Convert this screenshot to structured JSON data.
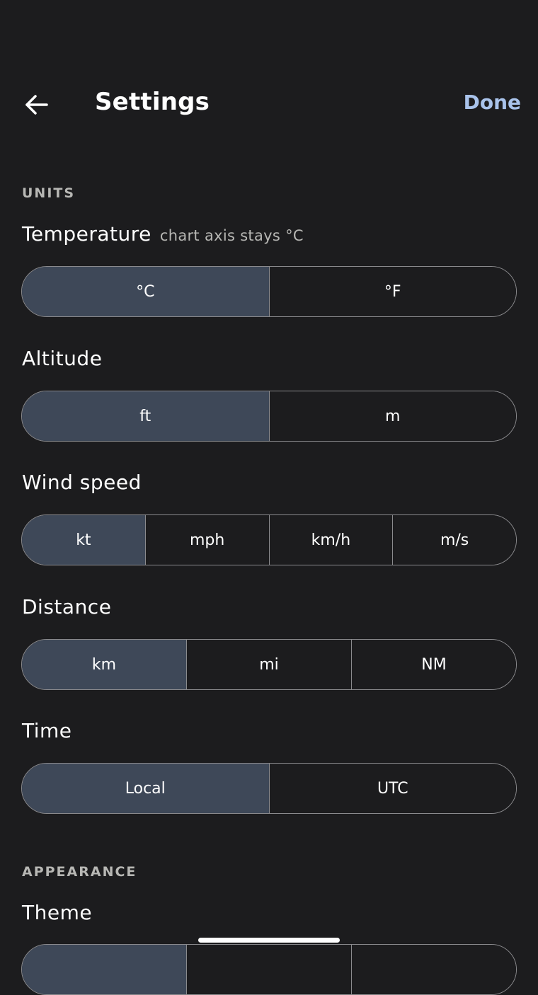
{
  "header": {
    "title": "Settings",
    "done_label": "Done"
  },
  "units": {
    "section_title": "UNITS",
    "temperature": {
      "label": "Temperature",
      "hint": "chart axis stays °C",
      "options": [
        "°C",
        "°F"
      ],
      "selected": "°C"
    },
    "altitude": {
      "label": "Altitude",
      "options": [
        "ft",
        "m"
      ],
      "selected": "ft"
    },
    "wind_speed": {
      "label": "Wind speed",
      "options": [
        "kt",
        "mph",
        "km/h",
        "m/s"
      ],
      "selected": "kt"
    },
    "distance": {
      "label": "Distance",
      "options": [
        "km",
        "mi",
        "NM"
      ],
      "selected": "km"
    },
    "time": {
      "label": "Time",
      "options": [
        "Local",
        "UTC"
      ],
      "selected": "Local"
    }
  },
  "appearance": {
    "section_title": "APPEARANCE",
    "theme": {
      "label": "Theme"
    }
  },
  "colors": {
    "background": "#1c1c1e",
    "selected_segment": "#3e4858",
    "accent": "#a9c3eb",
    "border": "#8a8a8d",
    "muted_text": "#b7b7b4"
  },
  "icons": {
    "back": "arrow-left-icon"
  }
}
